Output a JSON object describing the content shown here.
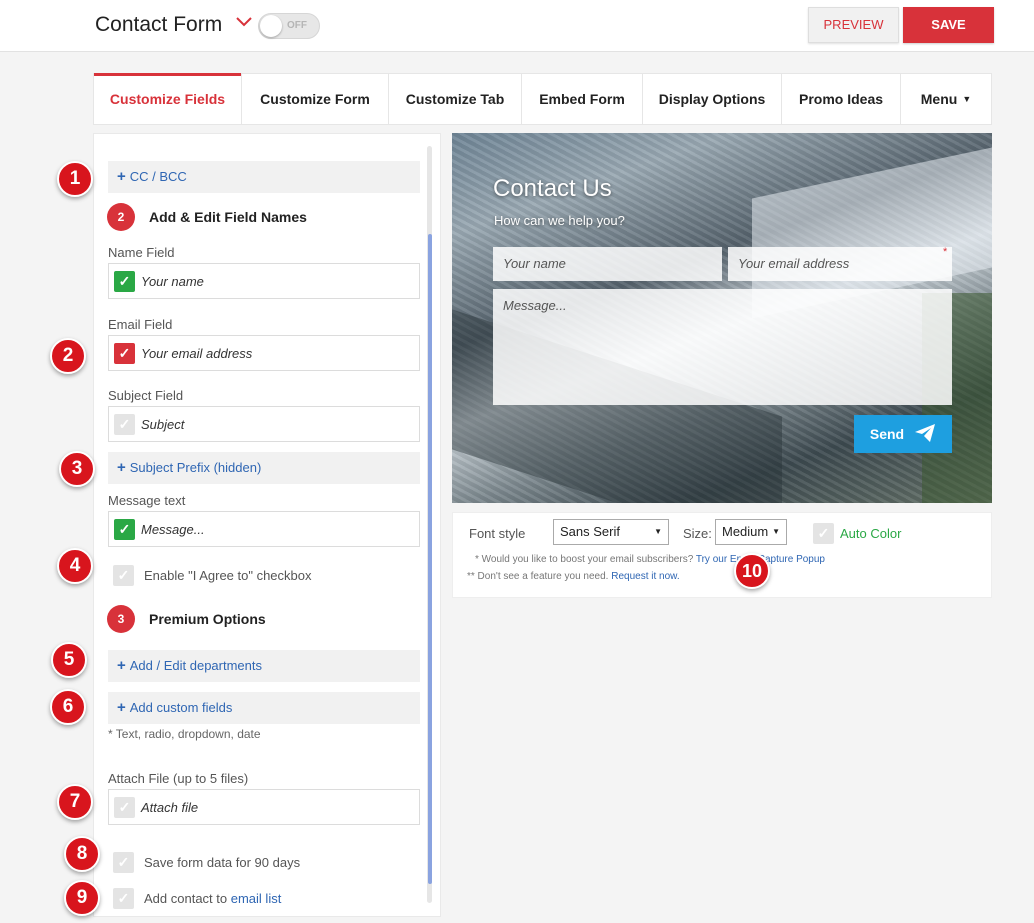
{
  "header": {
    "title": "Contact Form",
    "toggle_label": "OFF",
    "preview_label": "PREVIEW",
    "save_label": "SAVE"
  },
  "tabs": [
    {
      "label": "Customize Fields",
      "active": true
    },
    {
      "label": "Customize Form"
    },
    {
      "label": "Customize Tab"
    },
    {
      "label": "Embed Form"
    },
    {
      "label": "Display Options"
    },
    {
      "label": "Promo Ideas"
    },
    {
      "label": "Menu"
    }
  ],
  "left": {
    "cc_bcc": "CC / BCC",
    "section2": {
      "num": "2",
      "title": "Add & Edit Field Names"
    },
    "name_field": {
      "label": "Name Field",
      "value": "Your name"
    },
    "email_field": {
      "label": "Email Field",
      "value": "Your email address"
    },
    "subject_field": {
      "label": "Subject Field",
      "value": "Subject"
    },
    "subject_prefix": "Subject Prefix (hidden)",
    "message_field": {
      "label": "Message text",
      "value": "Message..."
    },
    "agree_checkbox": "Enable \"I Agree to\" checkbox",
    "section3": {
      "num": "3",
      "title": "Premium Options"
    },
    "departments": "Add / Edit departments",
    "custom_fields": "Add custom fields",
    "custom_fields_note": "* Text, radio, dropdown, date",
    "attach": {
      "label": "Attach File (up to 5 files)",
      "value": "Attach file"
    },
    "save_data": "Save form data for 90 days",
    "add_contact": "Add contact to ",
    "email_list": "email list"
  },
  "callouts": [
    "1",
    "2",
    "3",
    "4",
    "5",
    "6",
    "7",
    "8",
    "9",
    "10"
  ],
  "preview": {
    "title": "Contact Us",
    "subtitle": "How can we help you?",
    "name_placeholder": "Your name",
    "email_placeholder": "Your email address",
    "message_placeholder": "Message...",
    "send_label": "Send"
  },
  "options": {
    "font_style_label": "Font style",
    "font_style_value": "Sans Serif",
    "size_label": "Size:",
    "size_value": "Medium",
    "auto_color": "Auto Color",
    "boost_text": "* Would you like to boost your email subscribers? ",
    "boost_link": "Try our Email Capture Popup",
    "request_text": "** Don't see a feature you need. ",
    "request_link": "Request it now."
  },
  "colors": {
    "accent": "#d8323a",
    "link": "#2f66b3",
    "green": "#2aa845",
    "send": "#1e9fe0"
  }
}
